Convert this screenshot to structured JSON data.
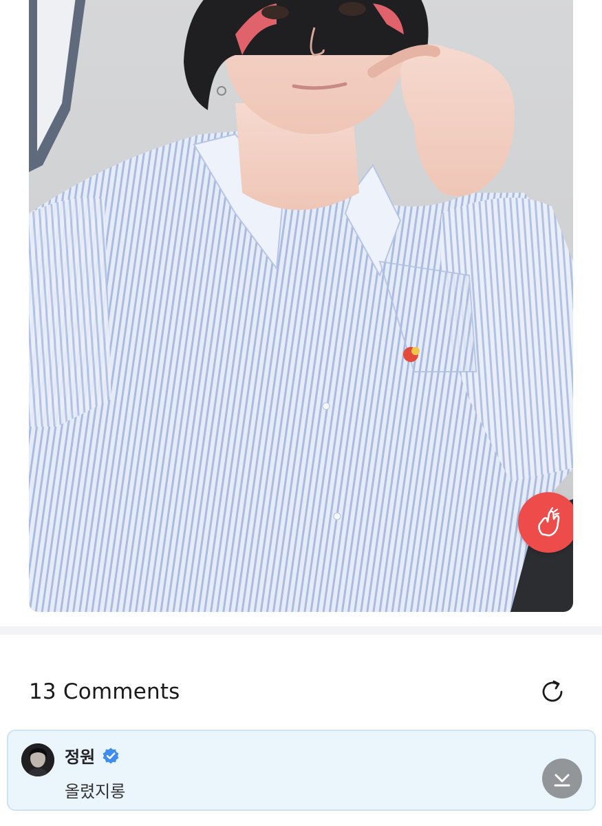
{
  "post": {
    "photo_alt": "selfie photo of a person in a striped shirt making a finger-heart gesture",
    "reaction_icon": "finger-heart-icon",
    "reaction_color": "#ee4b4b"
  },
  "comments": {
    "title": "13 Comments",
    "refresh_icon": "refresh-icon",
    "items": [
      {
        "author": "정원",
        "verified": true,
        "verified_color": "#3d8ef0",
        "text": "올렸지롱"
      }
    ],
    "scroll_icon": "scroll-to-bottom-icon"
  },
  "colors": {
    "highlight_bg": "#eaf5fc",
    "highlight_border": "#cfe4f1",
    "divider": "#f2f3f5"
  }
}
